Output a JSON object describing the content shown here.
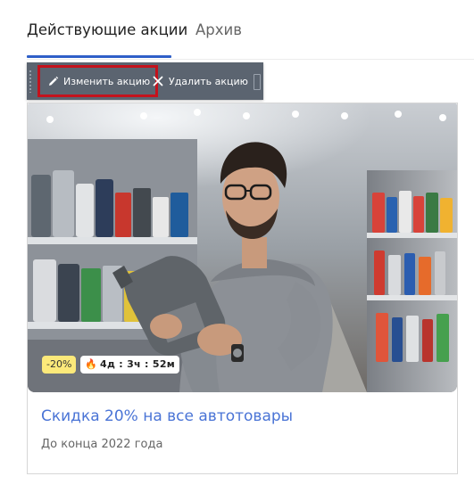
{
  "tabs": {
    "active": "Действующие акции",
    "archive": "Архив"
  },
  "toolbar": {
    "edit_label": "Изменить акцию",
    "delete_label": "Удалить акцию"
  },
  "promo": {
    "discount_badge": "-20%",
    "timer_badge": "4д : 3ч : 52м",
    "title": "Скидка 20% на все автотовары",
    "subtitle": "До конца 2022 года"
  },
  "colors": {
    "accent": "#2f5fc8",
    "link": "#4a74d6",
    "toolbar_bg": "#5b6470",
    "highlight_border": "#c4121c",
    "discount_badge_bg": "#fce97a"
  },
  "icons": [
    "pencil-icon",
    "close-icon",
    "fire-icon",
    "drag-handle-icon"
  ]
}
